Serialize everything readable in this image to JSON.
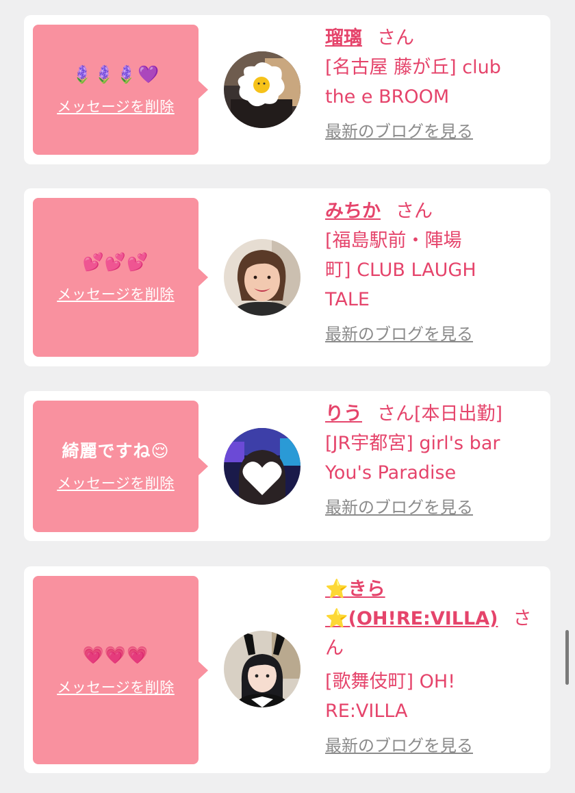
{
  "delete_label": "メッセージを削除",
  "blog_label": "最新のブログを見る",
  "san_label": "さん",
  "colors": {
    "accent": "#e5446b",
    "bubble": "#f9919f",
    "background": "#efeff0"
  },
  "cards": [
    {
      "message": "🪻🪻🪻💜",
      "name": "瑠璃",
      "suffix": "さん",
      "shop_lines": [
        "[名古屋 藤が丘] club",
        "the e BROOM"
      ],
      "avatar": "avatar-fried-egg-sticker"
    },
    {
      "message": "💕💕💕",
      "name": "みちか",
      "suffix": "さん",
      "shop_lines": [
        "[福島駅前・陣場",
        "町] CLUB LAUGH",
        "TALE"
      ],
      "avatar": "avatar-smiling-woman"
    },
    {
      "message": "綺麗ですね😌",
      "name": "りう",
      "suffix": "さん[本日出勤]",
      "shop_lines": [
        "[JR宇都宮] girl's bar",
        "You's Paradise"
      ],
      "avatar": "avatar-heart-sticker"
    },
    {
      "message": "💗💗💗",
      "name_line1": "⭐きら",
      "name_line2": "⭐(OH!RE:VILLA)",
      "suffix_a": "さ",
      "suffix_b": "ん",
      "shop_lines": [
        "[歌舞伎町] OH!",
        "RE:VILLA"
      ],
      "avatar": "avatar-bunny-ears-girl"
    }
  ]
}
